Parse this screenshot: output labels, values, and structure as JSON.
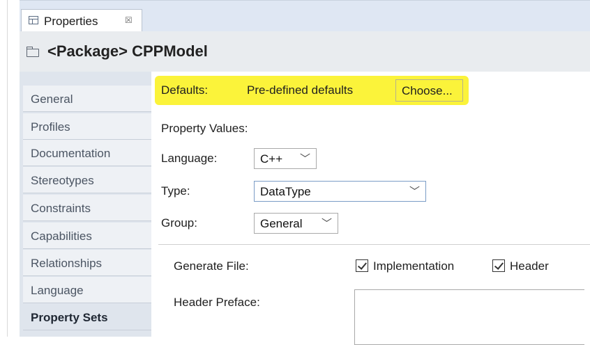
{
  "tab": {
    "label": "Properties",
    "close_symbol": "☒"
  },
  "title": {
    "stereotype": "<Package>",
    "name": "CPPModel"
  },
  "sidebar": {
    "items": [
      {
        "label": "General"
      },
      {
        "label": "Profiles"
      },
      {
        "label": "Documentation"
      },
      {
        "label": "Stereotypes"
      },
      {
        "label": "Constraints"
      },
      {
        "label": "Capabilities"
      },
      {
        "label": "Relationships"
      },
      {
        "label": "Language"
      },
      {
        "label": "Property Sets",
        "active": true
      }
    ]
  },
  "defaults": {
    "label": "Defaults:",
    "value": "Pre-defined defaults",
    "choose_label": "Choose...",
    "highlight_color": "#fbf33a"
  },
  "property_values": {
    "label": "Property Values:"
  },
  "language": {
    "label": "Language:",
    "value": "C++"
  },
  "type": {
    "label": "Type:",
    "value": "DataType"
  },
  "group": {
    "label": "Group:",
    "value": "General"
  },
  "generate_file": {
    "label": "Generate File:",
    "implementation_label": "Implementation",
    "implementation_checked": true,
    "header_label": "Header",
    "header_checked": true
  },
  "header_preface": {
    "label": "Header Preface:",
    "value": ""
  }
}
